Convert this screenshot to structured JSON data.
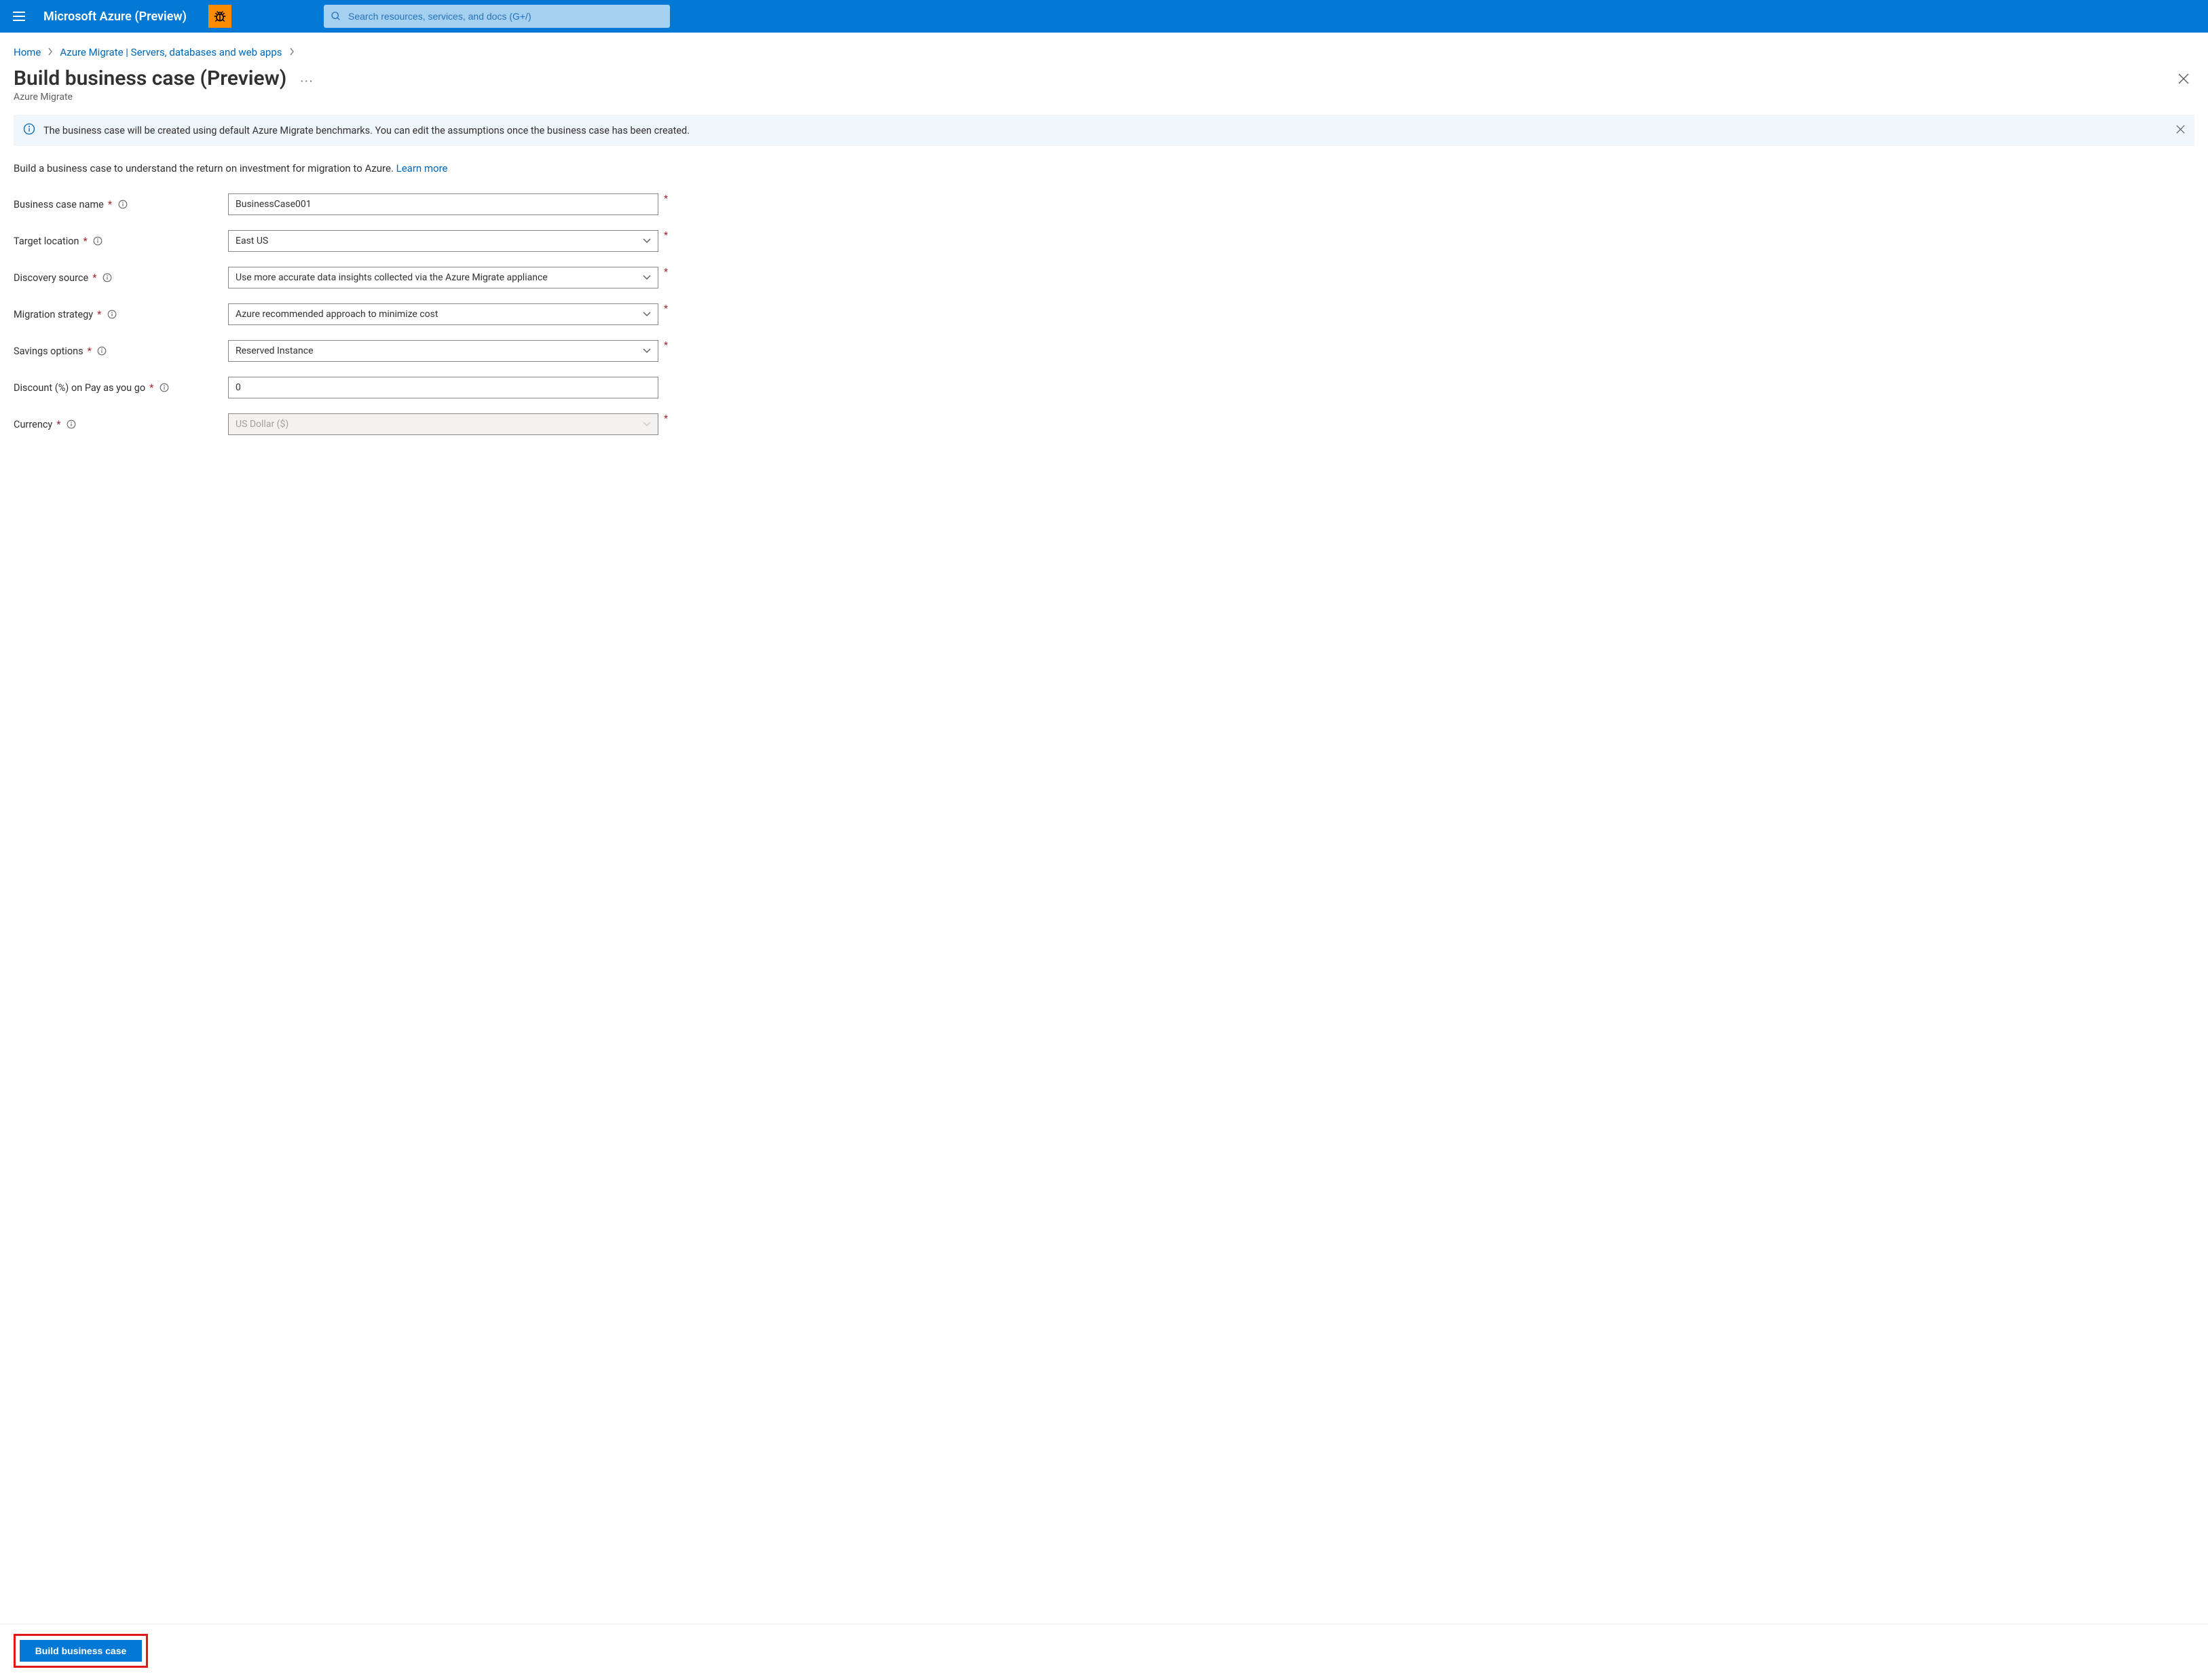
{
  "header": {
    "brand": "Microsoft Azure (Preview)",
    "search_placeholder": "Search resources, services, and docs (G+/)"
  },
  "breadcrumbs": {
    "home": "Home",
    "migrate": "Azure Migrate | Servers, databases and web apps"
  },
  "page": {
    "title": "Build business case (Preview)",
    "subtitle": "Azure Migrate"
  },
  "banner": {
    "text": "The business case will be created using default Azure Migrate benchmarks. You can edit the assumptions once the business case has been created."
  },
  "description": {
    "text": "Build a business case to understand the return on investment for migration to Azure. ",
    "learn_more": "Learn more"
  },
  "form": {
    "business_case_name": {
      "label": "Business case name",
      "value": "BusinessCase001"
    },
    "target_location": {
      "label": "Target location",
      "value": "East US"
    },
    "discovery_source": {
      "label": "Discovery source",
      "value": "Use more accurate data insights collected via the Azure Migrate appliance"
    },
    "migration_strategy": {
      "label": "Migration strategy",
      "value": "Azure recommended approach to minimize cost"
    },
    "savings_options": {
      "label": "Savings options",
      "value": "Reserved Instance"
    },
    "discount": {
      "label": "Discount (%) on Pay as you go",
      "value": "0"
    },
    "currency": {
      "label": "Currency",
      "value": "US Dollar ($)"
    }
  },
  "actions": {
    "build": "Build business case"
  }
}
